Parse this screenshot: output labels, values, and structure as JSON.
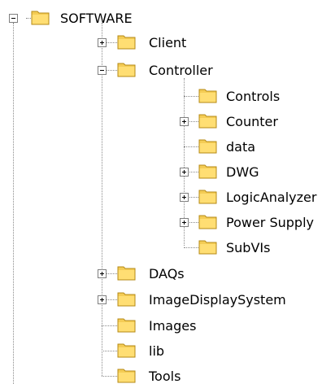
{
  "tree": {
    "root": {
      "label": "SOFTWARE",
      "icon": "folder-icon",
      "expanded": true
    },
    "children": [
      {
        "label": "Client",
        "icon": "folder-icon",
        "toggle": "plus"
      },
      {
        "label": "Controller",
        "icon": "folder-icon",
        "toggle": "minus",
        "children": [
          {
            "label": "Controls",
            "icon": "folder-icon",
            "toggle": null
          },
          {
            "label": "Counter",
            "icon": "folder-icon",
            "toggle": "plus"
          },
          {
            "label": "data",
            "icon": "folder-icon",
            "toggle": null
          },
          {
            "label": "DWG",
            "icon": "folder-icon",
            "toggle": "plus"
          },
          {
            "label": "LogicAnalyzer",
            "icon": "folder-icon",
            "toggle": "plus"
          },
          {
            "label": "Power Supply",
            "icon": "folder-icon",
            "toggle": "plus"
          },
          {
            "label": "SubVIs",
            "icon": "folder-icon",
            "toggle": null
          }
        ]
      },
      {
        "label": "DAQs",
        "icon": "folder-icon",
        "toggle": "plus"
      },
      {
        "label": "ImageDisplaySystem",
        "icon": "folder-icon",
        "toggle": "plus"
      },
      {
        "label": "Images",
        "icon": "folder-icon",
        "toggle": null
      },
      {
        "label": "lib",
        "icon": "folder-icon",
        "toggle": null
      },
      {
        "label": "Tools",
        "icon": "folder-icon",
        "toggle": null
      }
    ]
  },
  "colors": {
    "folder": "#f4cc55",
    "folder_dark": "#b58a16",
    "line": "#8a8a8a"
  }
}
